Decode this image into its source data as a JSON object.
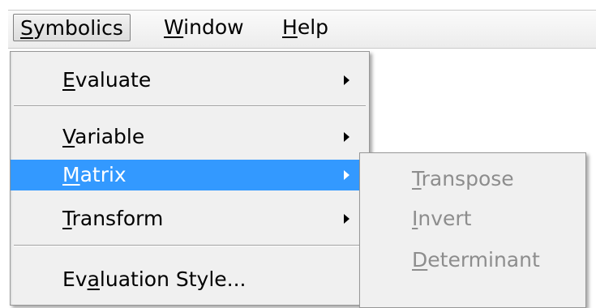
{
  "menubar": {
    "items": [
      {
        "label": "Symbolics",
        "mnemonic": "S",
        "rest": "ymbolics"
      },
      {
        "label": "Window",
        "mnemonic": "W",
        "rest": "indow"
      },
      {
        "label": "Help",
        "mnemonic": "H",
        "rest": "elp"
      }
    ]
  },
  "symbolics_menu": {
    "items": [
      {
        "pre": "",
        "mnemonic": "E",
        "post": "valuate",
        "has_submenu": true
      },
      {
        "pre": "",
        "mnemonic": "V",
        "post": "ariable",
        "has_submenu": true
      },
      {
        "pre": "",
        "mnemonic": "M",
        "post": "atrix",
        "has_submenu": true,
        "highlighted": true
      },
      {
        "pre": "",
        "mnemonic": "T",
        "post": "ransform",
        "has_submenu": true
      },
      {
        "pre": "Ev",
        "mnemonic": "a",
        "post": "luation Style...",
        "has_submenu": false
      }
    ]
  },
  "matrix_submenu": {
    "items": [
      {
        "mnemonic": "T",
        "post": "ranspose",
        "enabled": false
      },
      {
        "mnemonic": "I",
        "post": "nvert",
        "enabled": false
      },
      {
        "mnemonic": "D",
        "post": "eterminant",
        "enabled": false
      }
    ]
  },
  "colors": {
    "highlight": "#3399ff",
    "disabled_text": "#8d8d8d",
    "menu_bg": "#f0f0f0"
  }
}
